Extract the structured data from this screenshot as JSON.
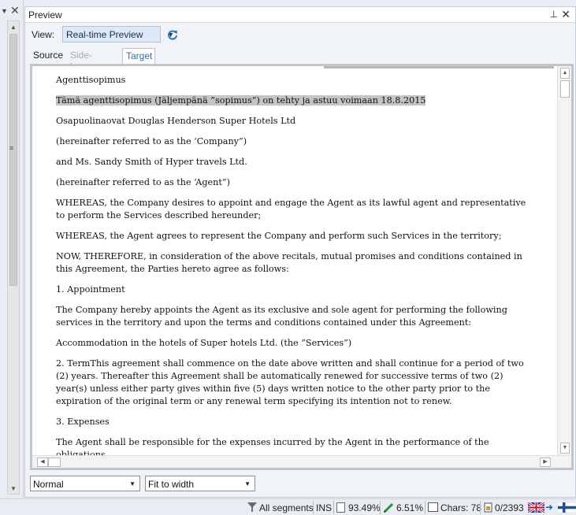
{
  "pane": {
    "title": "Preview"
  },
  "view": {
    "label": "View:",
    "selected": "Real-time Preview"
  },
  "tabs": [
    {
      "label": "Source",
      "state": "normal"
    },
    {
      "label": "Side-by-side",
      "state": "disabled"
    },
    {
      "label": "Target",
      "state": "active"
    }
  ],
  "document": {
    "paragraphs": [
      "Agenttisopimus",
      "Tämä agenttisopimus (Jäljempänä ”sopimus”) on tehty ja astuu voimaan 18.8.2015",
      "Osapuolinaovat Douglas Henderson Super Hotels Ltd",
      " (hereinafter referred to as the ‘Company”)",
      "and Ms. Sandy Smith of Hyper travels Ltd.",
      "(hereinafter referred to as the ‘Agent”)",
      "WHEREAS, the Company desires to appoint and engage the Agent as its lawful agent and representative to perform the Services described hereunder;",
      "WHEREAS, the Agent agrees to represent the Company and perform such Services in the territory;",
      "NOW, THEREFORE, in consideration of the above recitals, mutual promises and conditions contained in this Agreement, the Parties hereto agree as follows:",
      "1. Appointment",
      "The Company hereby appoints the Agent as its exclusive and sole agent for performing the following services in the territory and upon the terms and conditions contained under this Agreement:",
      "Accommodation in the hotels of Super hotels Ltd. (the “Services”)",
      "2. TermThis agreement shall commence on the date above written and shall continue for a period of two (2) years. Thereafter this Agreement shall be automatically renewed for successive terms of two (2) year(s) unless either party gives within five (5) days written notice to the other party prior to the expiration of the original term or any renewal term specifying its intention not to renew.",
      "3. Expenses",
      "The Agent shall be responsible for the expenses incurred by the Agent in the performance of the obligations"
    ]
  },
  "style_select": {
    "selected": "Normal"
  },
  "fit_select": {
    "selected": "Fit to width"
  },
  "status": {
    "filter": "All segments",
    "mode": "INS",
    "doc_percent": "93.49%",
    "edit_percent": "6.51%",
    "chars": "Chars: 78",
    "segments": "0/2393"
  },
  "colors": {
    "accent": "#2a6fb8",
    "highlight": "#c4c4c4",
    "view_select_bg": "#dde9f7"
  },
  "icons": [
    "close-icon",
    "pin-icon",
    "refresh-icon",
    "funnel-icon",
    "page-icon",
    "pen-icon",
    "chars-icon",
    "lock-icon",
    "flag-gb-icon",
    "flag-fi-icon"
  ]
}
